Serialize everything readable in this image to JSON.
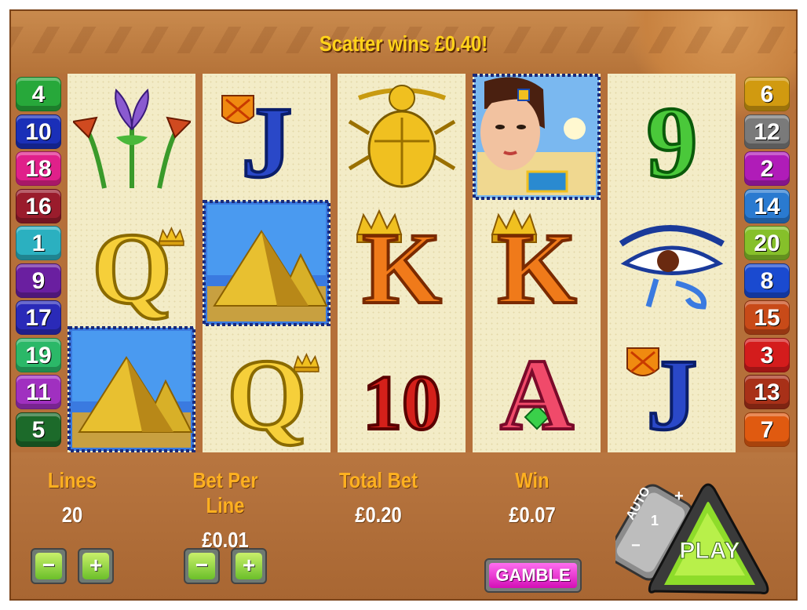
{
  "message": "Scatter wins £0.40!",
  "left_lines": [
    {
      "n": "4",
      "color": "#27a83a"
    },
    {
      "n": "10",
      "color": "#1a2fb8"
    },
    {
      "n": "18",
      "color": "#e0208a"
    },
    {
      "n": "16",
      "color": "#9a1c2c"
    },
    {
      "n": "1",
      "color": "#2bb0c0"
    },
    {
      "n": "9",
      "color": "#6a1fa0"
    },
    {
      "n": "17",
      "color": "#2a2ab8"
    },
    {
      "n": "19",
      "color": "#2bb868"
    },
    {
      "n": "11",
      "color": "#a030c0"
    },
    {
      "n": "5",
      "color": "#1c6a2a"
    }
  ],
  "right_lines": [
    {
      "n": "6",
      "color": "#d19a10"
    },
    {
      "n": "12",
      "color": "#7a7a7a"
    },
    {
      "n": "2",
      "color": "#b01cb8"
    },
    {
      "n": "14",
      "color": "#2a7ad0"
    },
    {
      "n": "20",
      "color": "#86c02a"
    },
    {
      "n": "8",
      "color": "#1a4ad0"
    },
    {
      "n": "15",
      "color": "#c84a18"
    },
    {
      "n": "3",
      "color": "#d41c1c"
    },
    {
      "n": "13",
      "color": "#a83018"
    },
    {
      "n": "7",
      "color": "#e05a10"
    }
  ],
  "reels": [
    [
      "lotus",
      "Q",
      "pyramids"
    ],
    [
      "J",
      "pyramids",
      "Q"
    ],
    [
      "scarab",
      "K",
      "10"
    ],
    [
      "cleopatra",
      "K",
      "A"
    ],
    [
      "9",
      "eye-of-horus",
      "J"
    ]
  ],
  "card_labels": {
    "J": "J",
    "Q": "Q",
    "K": "K",
    "A": "A",
    "10": "10",
    "9": "9"
  },
  "bottom": {
    "lines_label": "Lines",
    "lines_value": "20",
    "bet_label": "Bet Per Line",
    "bet_value": "£0.01",
    "total_label": "Total Bet",
    "total_value": "£0.20",
    "win_label": "Win",
    "win_value": "£0.07",
    "minus": "−",
    "plus": "+",
    "gamble": "GAMBLE"
  },
  "play": {
    "label": "PLAY",
    "auto": "AUTO",
    "auto_count": "1",
    "plus": "+",
    "minus": "−"
  }
}
